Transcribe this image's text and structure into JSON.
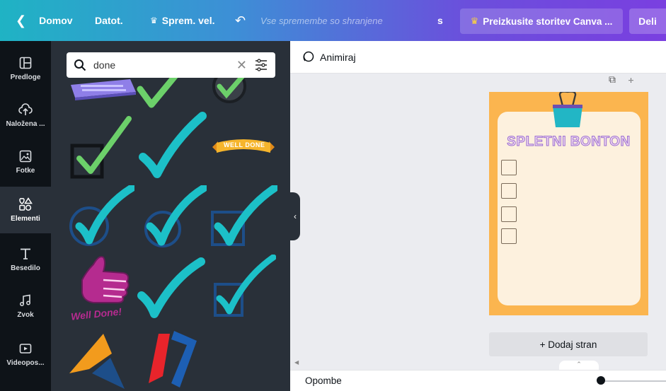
{
  "topbar": {
    "home": "Domov",
    "file": "Datot.",
    "resize": "Sprem. vel.",
    "saved_status": "Vse spremembe so shranjene",
    "s_label": "s",
    "try_label": "Preizkusite storitev Canva ...",
    "share": "Deli"
  },
  "rail": {
    "items": [
      {
        "label": "Predloge",
        "icon": "templates-icon"
      },
      {
        "label": "Naložena ...",
        "icon": "upload-icon"
      },
      {
        "label": "Fotke",
        "icon": "photos-icon"
      },
      {
        "label": "Elementi",
        "icon": "elements-icon"
      },
      {
        "label": "Besedilo",
        "icon": "text-icon"
      },
      {
        "label": "Zvok",
        "icon": "audio-icon"
      },
      {
        "label": "Videopos...",
        "icon": "video-icon"
      }
    ]
  },
  "search": {
    "value": "done"
  },
  "elements": {
    "well_done_banner": "WELL DONE",
    "well_done_thumb": "Well Done!"
  },
  "canvas": {
    "animate": "Animiraj",
    "page_title": "SPLETNI BONTON",
    "add_page": "+ Dodaj stran",
    "notes": "Opombe"
  },
  "colors": {
    "check_teal": "#1cc0c8",
    "check_green": "#6cd06a",
    "page_orange": "#fbb54f",
    "paper_cream": "#fdf1de"
  }
}
